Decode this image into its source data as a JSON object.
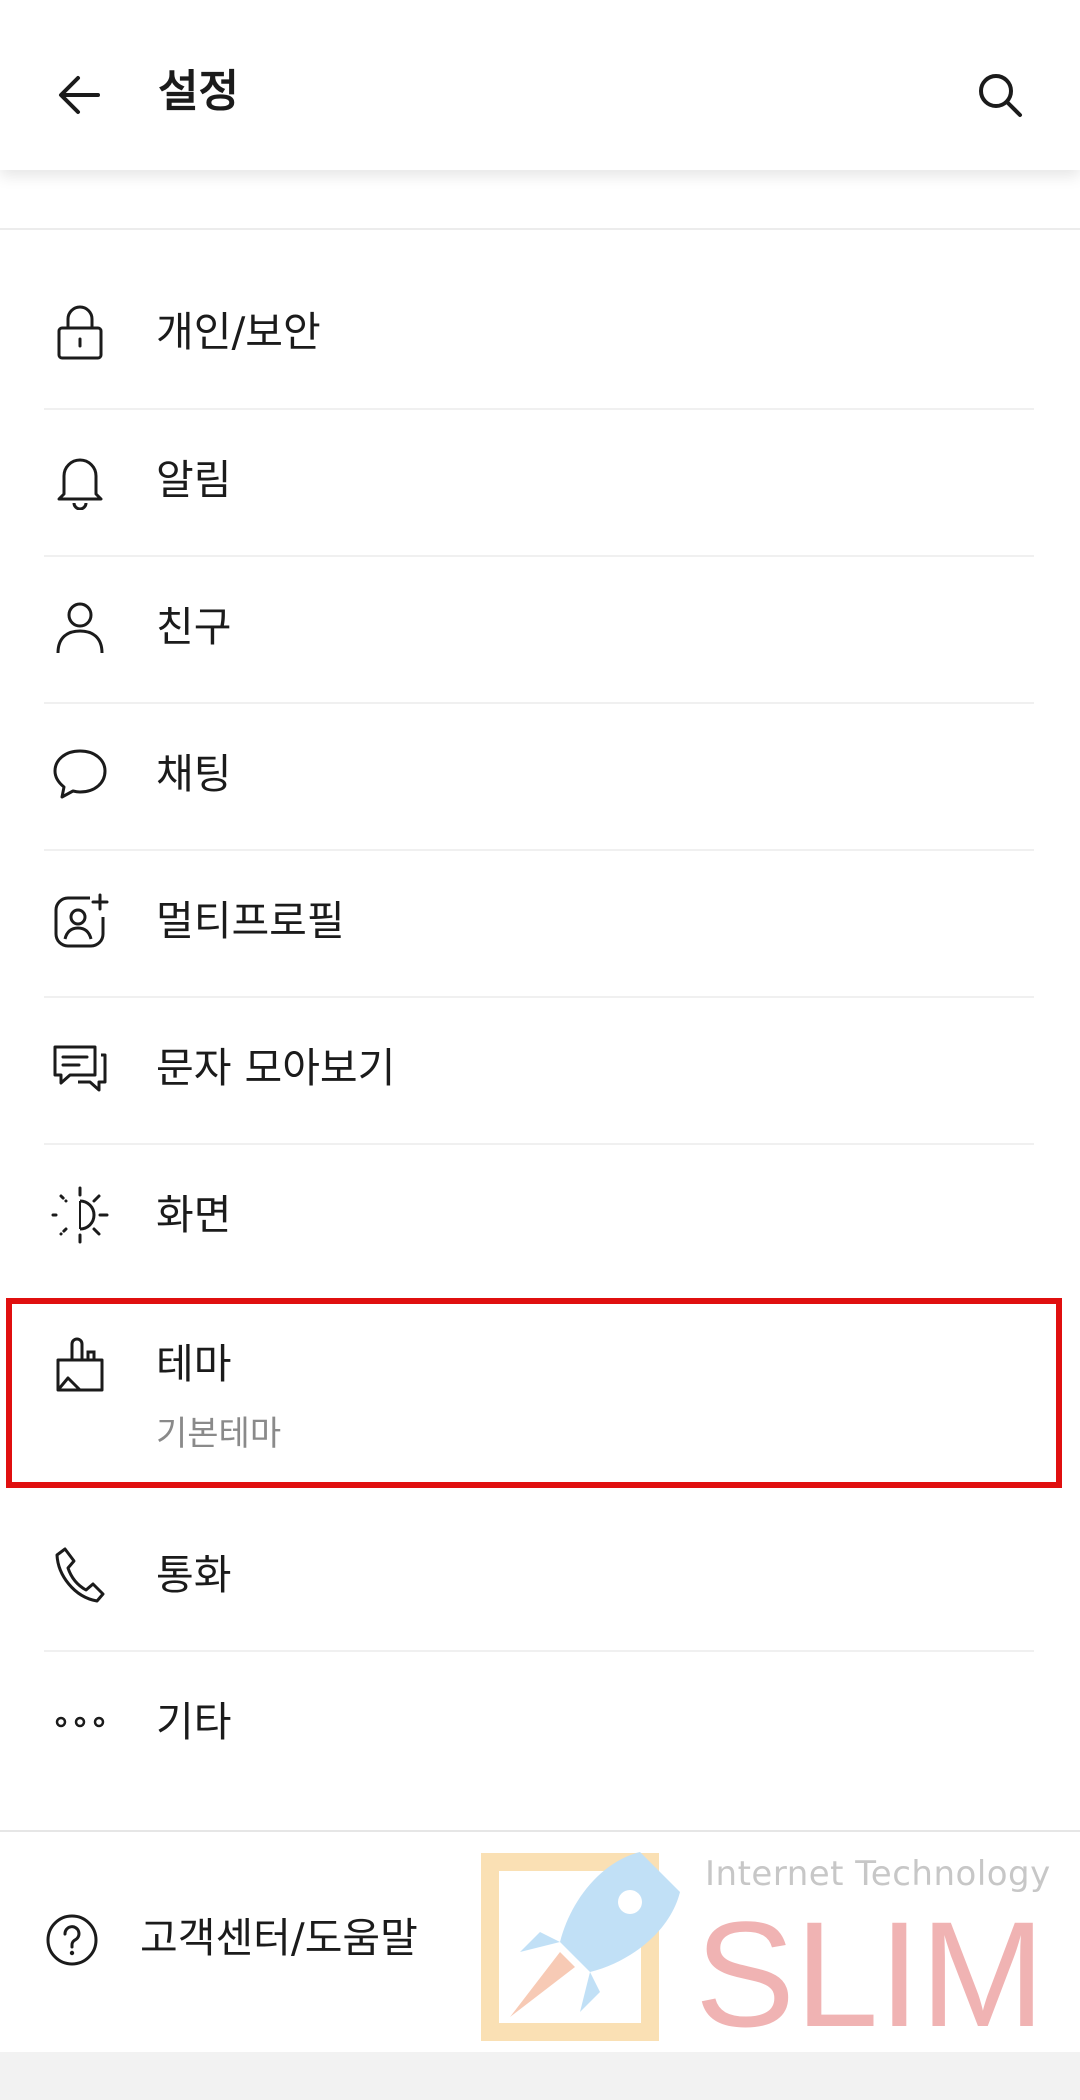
{
  "header": {
    "title": "설정"
  },
  "menu": [
    {
      "label": "개인/보안",
      "icon": "lock-icon"
    },
    {
      "label": "알림",
      "icon": "bell-icon"
    },
    {
      "label": "친구",
      "icon": "person-icon"
    },
    {
      "label": "채팅",
      "icon": "chat-bubble-icon"
    },
    {
      "label": "멀티프로필",
      "icon": "multi-profile-icon"
    },
    {
      "label": "문자 모아보기",
      "icon": "message-stack-icon"
    },
    {
      "label": "화면",
      "icon": "brightness-icon"
    },
    {
      "label": "테마",
      "sublabel": "기본테마",
      "icon": "paint-brush-icon"
    },
    {
      "label": "통화",
      "icon": "phone-icon"
    },
    {
      "label": "기타",
      "icon": "more-dots-icon"
    }
  ],
  "help": {
    "label": "고객센터/도움말",
    "icon": "question-circle-icon"
  },
  "watermark": {
    "subtitle": "Internet Technology",
    "brand": "SLIM"
  },
  "colors": {
    "highlight": "#e00f0f",
    "text": "#1b1b1b",
    "sublabel": "#8a8a8a"
  }
}
